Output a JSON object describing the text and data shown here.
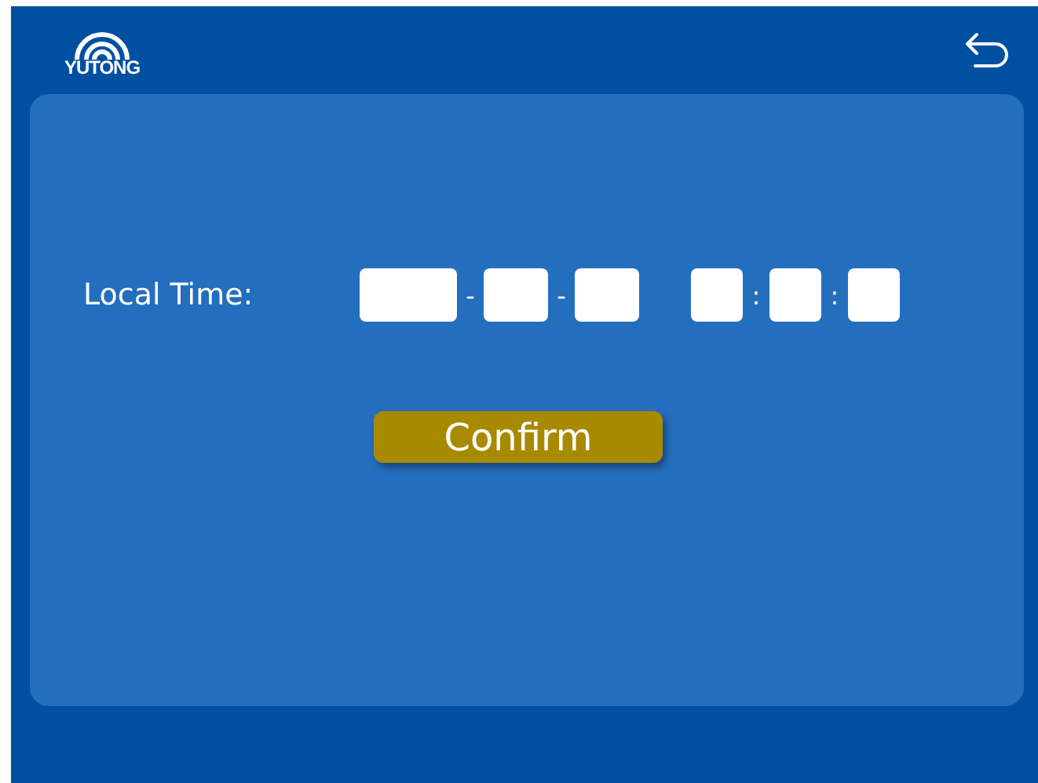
{
  "header": {
    "logo_text": "YUTONG"
  },
  "form": {
    "label": "Local Time:",
    "date": [
      {
        "kind": "wide-field"
      },
      {
        "kind": "separator",
        "text": "-"
      },
      {
        "kind": "field"
      },
      {
        "kind": "separator",
        "text": "-"
      },
      {
        "kind": "field"
      }
    ],
    "time": [
      {
        "kind": "narrow-field"
      },
      {
        "kind": "separator",
        "text": ":"
      },
      {
        "kind": "narrow-field"
      },
      {
        "kind": "separator",
        "text": ":"
      },
      {
        "kind": "narrow-field"
      }
    ]
  },
  "buttons": [
    {
      "label": "Confirm"
    }
  ]
}
